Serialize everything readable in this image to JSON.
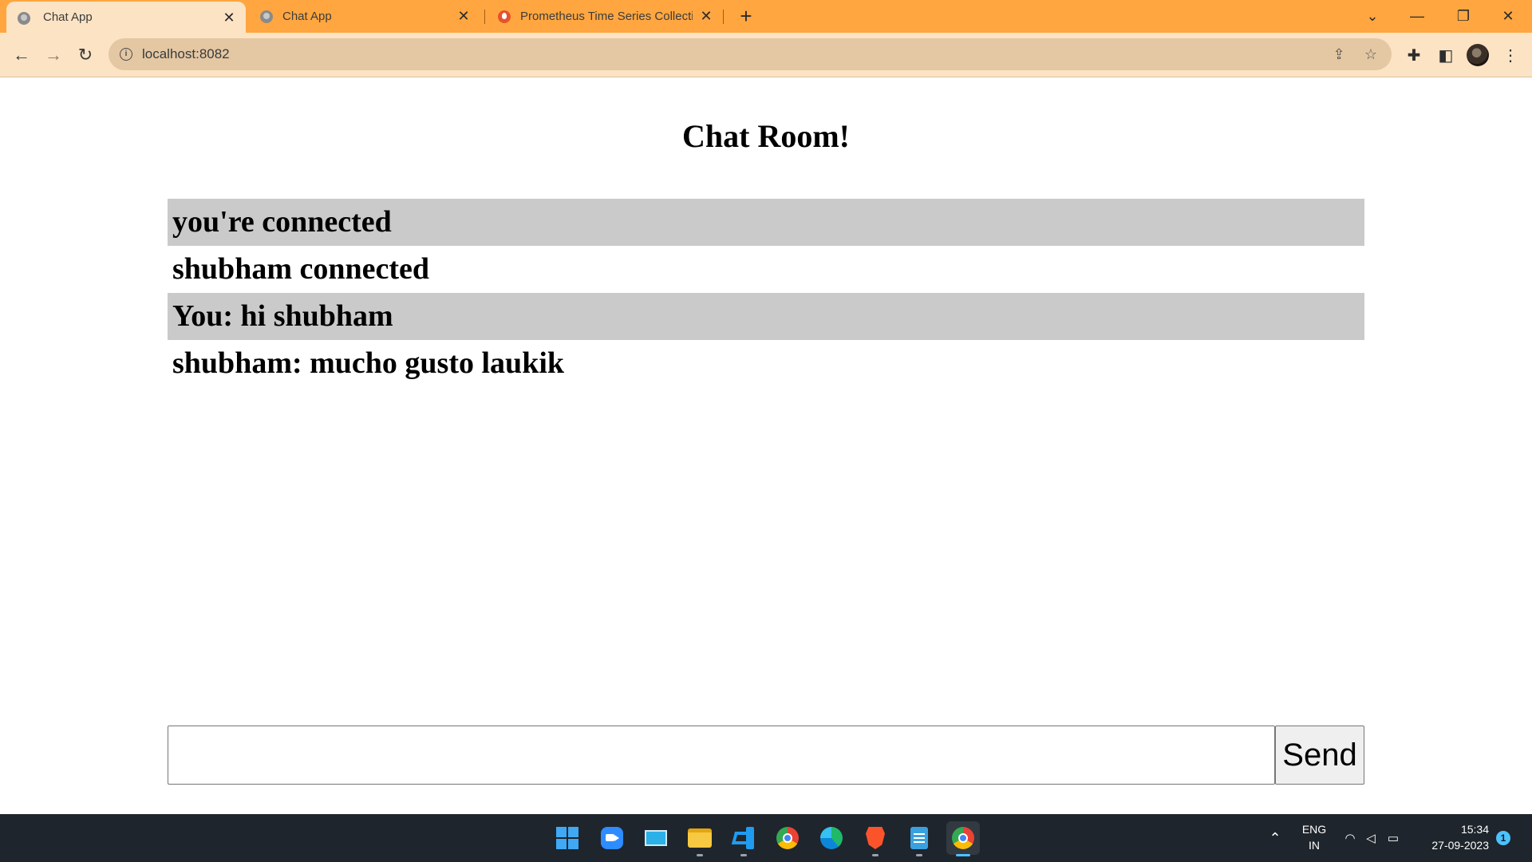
{
  "browser": {
    "tabs": [
      {
        "title": "Chat App",
        "icon": "globe-icon",
        "active": true
      },
      {
        "title": "Chat App",
        "icon": "globe-icon",
        "active": false
      },
      {
        "title": "Prometheus Time Series Collecti",
        "icon": "prometheus-icon",
        "active": false
      }
    ],
    "url": "localhost:8082"
  },
  "page": {
    "title": "Chat Room!",
    "messages": [
      "you're connected",
      "shubham connected",
      "You: hi shubham",
      "shubham: mucho gusto laukik"
    ],
    "input_value": "",
    "send_label": "Send"
  },
  "taskbar": {
    "apps": [
      "start-icon",
      "zoom-icon",
      "remote-desktop-icon",
      "file-explorer-icon",
      "vscode-icon",
      "chrome-icon",
      "edge-icon",
      "brave-icon",
      "notepad-icon",
      "chrome-icon"
    ],
    "lang_top": "ENG",
    "lang_bottom": "IN",
    "time": "15:34",
    "date": "27-09-2023",
    "notification_count": "1"
  },
  "colors": {
    "tab_strip": "#ffa640",
    "toolbar": "#fbe3c4",
    "message_stripe": "#cacaca",
    "taskbar": "#1f252c"
  }
}
